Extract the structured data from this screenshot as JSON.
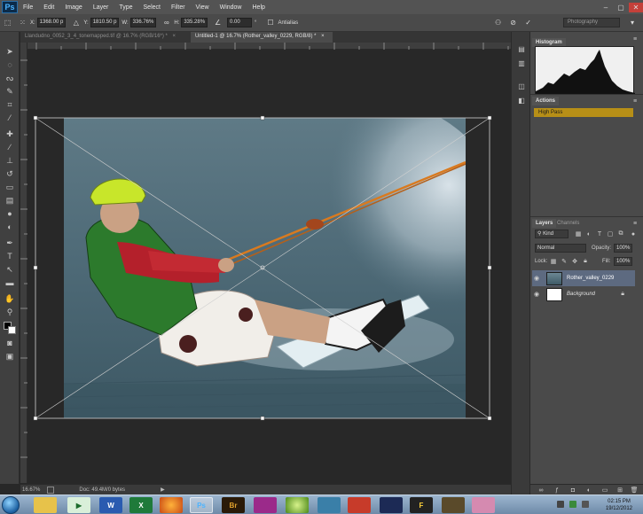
{
  "menubar": {
    "logo": "Ps",
    "items": [
      "File",
      "Edit",
      "Image",
      "Layer",
      "Type",
      "Select",
      "Filter",
      "View",
      "Window",
      "Help"
    ],
    "window_controls": [
      "–",
      "▢",
      "✕"
    ]
  },
  "options": {
    "x_label": "X:",
    "x_value": "1368.00 p",
    "y_label": "Y:",
    "y_value": "1810.50 p",
    "w_label": "W:",
    "w_value": "336.76%",
    "h_label": "H:",
    "h_value": "335.28%",
    "angle_value": "0.00",
    "angle_unit": "°",
    "antialias_label": "Antialias",
    "workspace": "Photography"
  },
  "tabs": [
    {
      "label": "Llandudno_0052_3_4_tonemapped.tif @ 16.7% (RGB/16*) *",
      "close": "×",
      "active": false
    },
    {
      "label": "Untitled-1 @ 16.7% (Rother_valley_0229, RGB/8) *",
      "close": "×",
      "active": true
    }
  ],
  "statusbar": {
    "zoom": "16.67%",
    "doc": "Doc: 49.4M/0 bytes",
    "arrow": "▶"
  },
  "panels": {
    "histogram_tab": "Histogram",
    "actions_tab": "Actions",
    "action_item": "High Pass",
    "layers_tab": "Layers",
    "channels_tab": "Channels",
    "kind_label": "Kind",
    "blend_mode": "Normal",
    "opacity_label": "Opacity:",
    "opacity_value": "100%",
    "lock_label": "Lock:",
    "fill_label": "Fill:",
    "fill_value": "100%",
    "layers": [
      {
        "name": "Rother_valley_0229",
        "selected": true
      },
      {
        "name": "Background",
        "selected": false
      }
    ]
  },
  "taskbar": {
    "clock_time": "02:15 PM",
    "clock_date": "19/12/2012"
  },
  "colors": {
    "action_highlight": "#b78f17",
    "selected_layer": "#5d6a80"
  }
}
